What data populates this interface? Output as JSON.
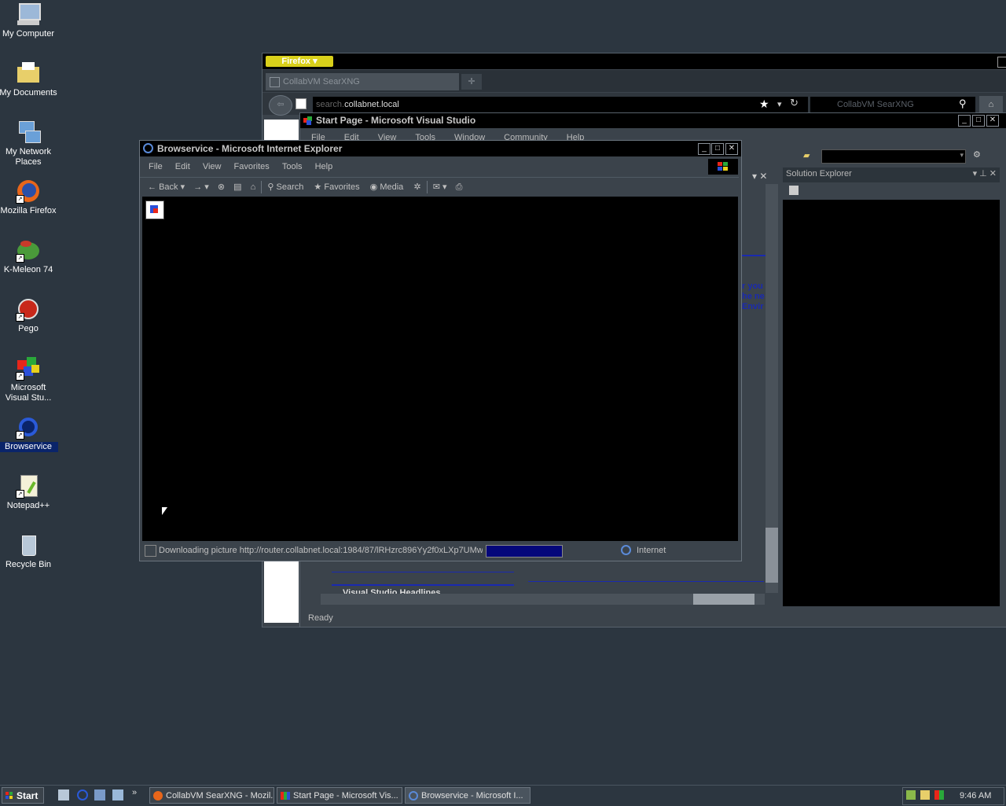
{
  "desktop": {
    "icons": [
      {
        "label": "My Computer",
        "top": 0
      },
      {
        "label": "My Documents",
        "top": 0
      },
      {
        "label": "My Network Places",
        "top": 0
      },
      {
        "label": "Mozilla Firefox",
        "top": 0
      },
      {
        "label": "K-Meleon 74",
        "top": 0
      },
      {
        "label": "Pego",
        "top": 0
      },
      {
        "label": "Microsoft Visual Stu...",
        "top": 0
      },
      {
        "label": "Browservice",
        "top": 0
      },
      {
        "label": "Notepad++",
        "top": 0
      },
      {
        "label": "Recycle Bin",
        "top": 0
      }
    ],
    "selected_index": 7
  },
  "firefox": {
    "menu_button": "Firefox",
    "tab_title": "CollabVM SearXNG",
    "url_prefix": "search.",
    "url_host": "collabnet.local",
    "search_placeholder": "CollabVM SearXNG"
  },
  "vs": {
    "title": "Start Page - Microsoft Visual Studio",
    "menu": [
      "File",
      "Edit",
      "View",
      "Tools",
      "Window",
      "Community",
      "Help"
    ],
    "solution_explorer": "Solution Explorer",
    "headlines": "Visual Studio Headlines",
    "status": "Ready",
    "frag1": "r you",
    "frag2": "he ne",
    "frag3": "Envir"
  },
  "ie": {
    "title": "Browservice - Microsoft Internet Explorer",
    "menu": [
      "File",
      "Edit",
      "View",
      "Favorites",
      "Tools",
      "Help"
    ],
    "toolbar": {
      "back": "Back",
      "search": "Search",
      "favorites": "Favorites",
      "media": "Media"
    },
    "status_text": "Downloading picture http://router.collabnet.local:1984/87/lRHzrc896Yy2f0xLXp7UMwl",
    "zone": "Internet",
    "progress_fraction": 1.0
  },
  "taskbar": {
    "start": "Start",
    "tasks": [
      "CollabVM SearXNG - Mozil...",
      "Start Page - Microsoft Vis...",
      "Browservice - Microsoft I..."
    ],
    "active_task": 2,
    "clock": "9:46 AM"
  },
  "colors": {
    "desktop": "#2c3640",
    "firefox_button": "#d9d01a",
    "progress": "#04077a",
    "selection": "#0a246a"
  }
}
